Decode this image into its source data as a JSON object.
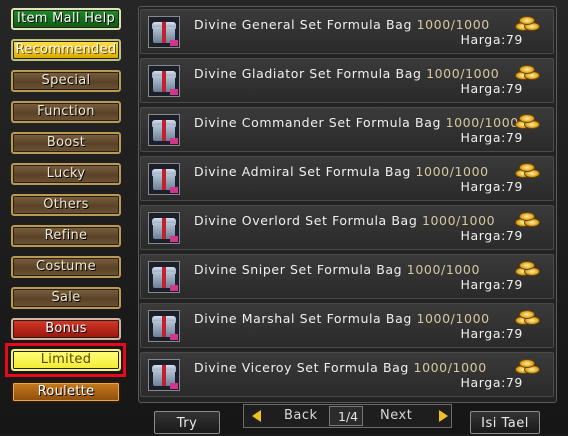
{
  "sidebar": {
    "items": [
      {
        "label": "Item Mall Help",
        "style": "green"
      },
      {
        "label": "Recommended",
        "style": "yellow"
      },
      {
        "label": "Special",
        "style": "brown"
      },
      {
        "label": "Function",
        "style": "brown"
      },
      {
        "label": "Boost",
        "style": "brown"
      },
      {
        "label": "Lucky",
        "style": "brown"
      },
      {
        "label": "Others",
        "style": "brown"
      },
      {
        "label": "Refine",
        "style": "brown"
      },
      {
        "label": "Costume",
        "style": "brown"
      },
      {
        "label": "Sale",
        "style": "brown"
      },
      {
        "label": "Bonus",
        "style": "red"
      },
      {
        "label": "Limited",
        "style": "limited",
        "selected": true
      },
      {
        "label": "Roulette",
        "style": "orange"
      }
    ]
  },
  "items": [
    {
      "name": "Divine General Set Formula Bag",
      "stock": "1000/1000",
      "price": "Harga:79"
    },
    {
      "name": "Divine Gladiator Set Formula Bag",
      "stock": "1000/1000",
      "price": "Harga:79"
    },
    {
      "name": "Divine Commander Set Formula Bag",
      "stock": "1000/1000",
      "price": "Harga:79"
    },
    {
      "name": "Divine Admiral Set Formula Bag",
      "stock": "1000/1000",
      "price": "Harga:79"
    },
    {
      "name": "Divine Overlord Set Formula Bag",
      "stock": "1000/1000",
      "price": "Harga:79"
    },
    {
      "name": "Divine Sniper Set Formula Bag",
      "stock": "1000/1000",
      "price": "Harga:79"
    },
    {
      "name": "Divine Marshal Set Formula Bag",
      "stock": "1000/1000",
      "price": "Harga:79"
    },
    {
      "name": "Divine Viceroy Set Formula Bag",
      "stock": "1000/1000",
      "price": "Harga:79"
    }
  ],
  "footer": {
    "try_label": "Try",
    "back_label": "Back",
    "page_indicator": "1/4",
    "next_label": "Next",
    "isi_tael_label": "Isi Tael"
  },
  "colors": {
    "selection_outline": "#e8091b",
    "arrow": "#f0c020"
  },
  "icons": {
    "item": "treasure-chest-icon",
    "currency": "gold-ingot-icon",
    "prev": "arrow-left-icon",
    "next": "arrow-right-icon"
  }
}
